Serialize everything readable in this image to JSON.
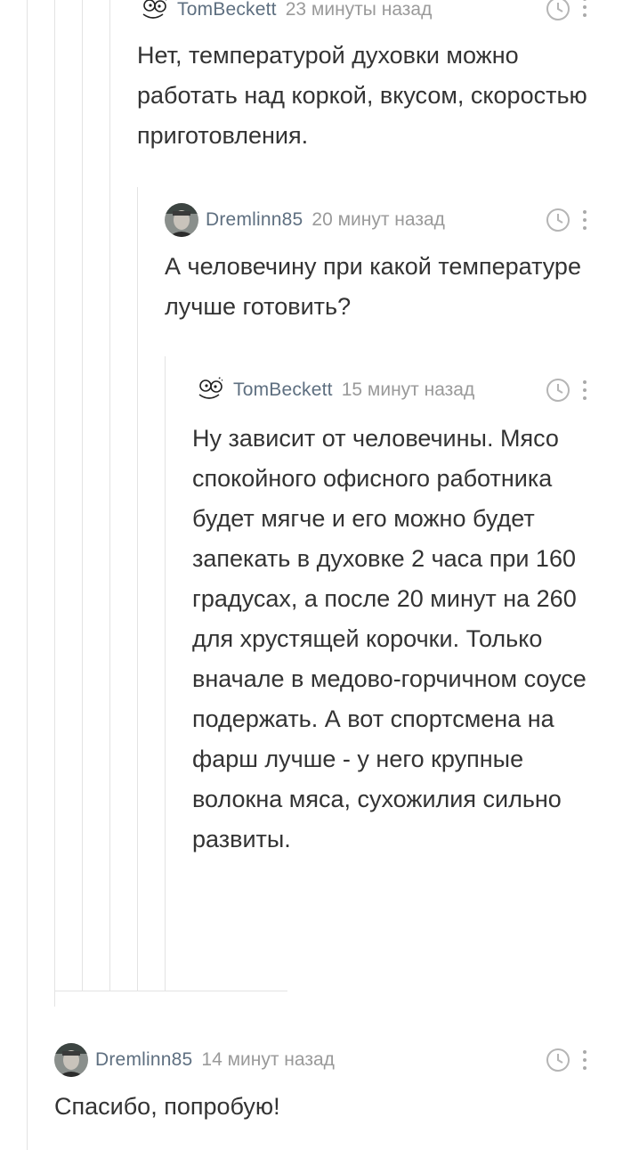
{
  "thread": {
    "comments": [
      {
        "username": "TomBeckett",
        "time": "23 минуты назад",
        "avatar_icon": "doodle-face-avatar",
        "text": "Нет, температурой духовки можно работать над коркой, вкусом, скоростью приготовления."
      },
      {
        "username": "Dremlinn85",
        "time": "20 минут назад",
        "avatar_icon": "photo-avatar",
        "text": "А человечину при какой температуре лучше готовить?"
      },
      {
        "username": "TomBeckett",
        "time": "15 минут назад",
        "avatar_icon": "doodle-face-avatar",
        "text": "Ну зависит от человечины. Мясо спокойного офисного работника будет мягче и его можно будет запекать в духовке 2 часа при 160 градусах, а после 20 минут на 260 для хрустящей корочки. Только вначале в медово-горчичном соусе подержать. А вот спортсмена на фарш лучше - у него крупные волокна мяса, сухожилия сильно развиты."
      },
      {
        "username": "Dremlinn85",
        "time": "14 минут назад",
        "avatar_icon": "photo-avatar",
        "text": "Спасибо, попробую!"
      }
    ]
  },
  "icons": {
    "clock": "clock-icon",
    "more": "more-vertical-icon"
  },
  "colors": {
    "username": "#5e6f80",
    "time": "#9a9a9a",
    "text": "#333333",
    "thread_line": "#e3e3e3"
  }
}
